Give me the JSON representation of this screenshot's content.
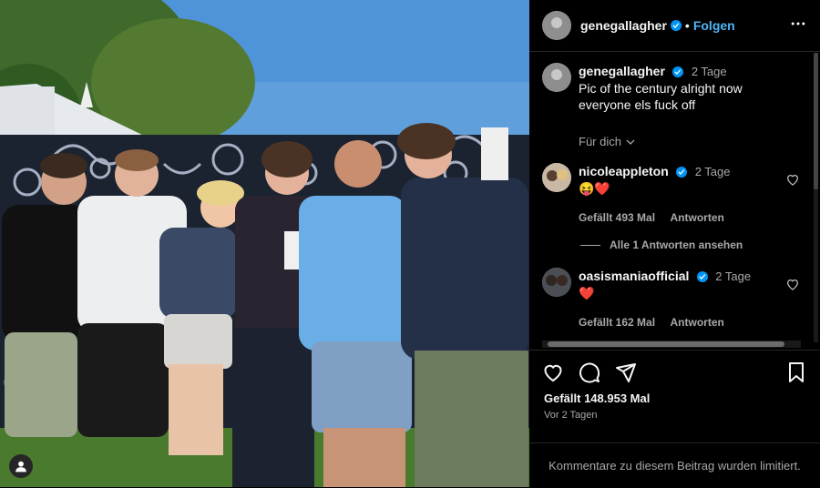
{
  "post": {
    "author": "genegallagher",
    "follow_label": "Folgen",
    "dot": "•",
    "more_label": "•••"
  },
  "caption": {
    "author": "genegallagher",
    "time": "2 Tage",
    "text": "Pic of the century alright now everyone els fuck off",
    "translate_label": "Für dich"
  },
  "comments": [
    {
      "author": "nicoleappleton",
      "time": "2 Tage",
      "text": "😝❤️",
      "likes": "Gefällt 493 Mal",
      "reply": "Antworten",
      "view_replies": "Alle 1 Antworten ansehen"
    },
    {
      "author": "oasismaniaofficial",
      "time": "2 Tage",
      "text": "❤️",
      "likes": "Gefällt 162 Mal",
      "reply": "Antworten"
    }
  ],
  "footer": {
    "likes": "Gefällt 148.953 Mal",
    "date": "Vor 2 Tagen",
    "limited": "Kommentare zu diesem Beitrag wurden limitiert."
  },
  "colors": {
    "accent": "#4cb5f9",
    "verified": "#0095f6",
    "heart_red": "#ff3040"
  },
  "icons": [
    "verified-badge-icon",
    "more-icon",
    "heart-icon",
    "comment-icon",
    "share-icon",
    "bookmark-icon",
    "chevron-down-icon",
    "user-icon"
  ]
}
